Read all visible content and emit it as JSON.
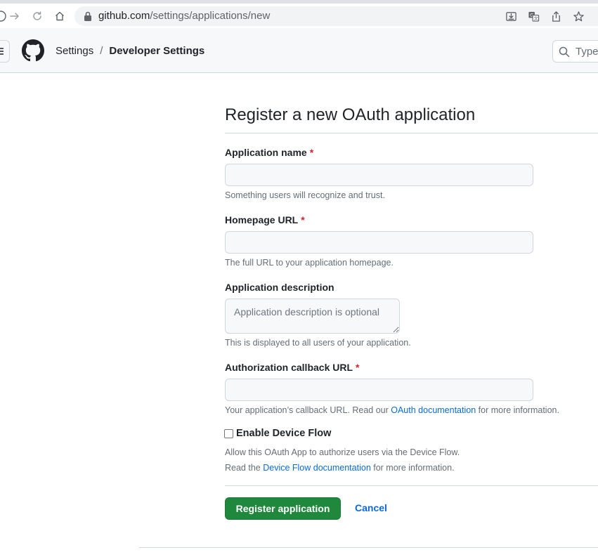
{
  "browser": {
    "url_host": "github.com",
    "url_path": "/settings/applications/new"
  },
  "header": {
    "breadcrumb_parent": "Settings",
    "breadcrumb_separator": "/",
    "breadcrumb_current": "Developer Settings",
    "search_placeholder": "Type"
  },
  "form": {
    "title": "Register a new OAuth application",
    "required_marker": "*",
    "app_name": {
      "label": "Application name",
      "value": "",
      "note": "Something users will recognize and trust."
    },
    "homepage": {
      "label": "Homepage URL",
      "value": "",
      "note": "The full URL to your application homepage."
    },
    "description": {
      "label": "Application description",
      "placeholder": "Application description is optional",
      "note": "This is displayed to all users of your application."
    },
    "callback": {
      "label": "Authorization callback URL",
      "value": "",
      "note_before": "Your application’s callback URL. Read our ",
      "note_link": "OAuth documentation",
      "note_after": " for more information."
    },
    "device_flow": {
      "label": "Enable Device Flow",
      "checked": false,
      "note_line1": "Allow this OAuth App to authorize users via the Device Flow.",
      "note_line2_before": "Read the ",
      "note_line2_link": "Device Flow documentation",
      "note_line2_after": " for more information."
    },
    "submit_label": "Register application",
    "cancel_label": "Cancel"
  },
  "colors": {
    "primary_button": "#1f883d",
    "link": "#0969da",
    "required": "#cf222e"
  },
  "icons": [
    "back-icon",
    "forward-icon",
    "reload-icon",
    "home-icon",
    "lock-icon",
    "install-icon",
    "translate-icon",
    "share-icon",
    "bookmark-star-icon",
    "hamburger-menu-icon",
    "github-logo-icon",
    "search-icon"
  ]
}
